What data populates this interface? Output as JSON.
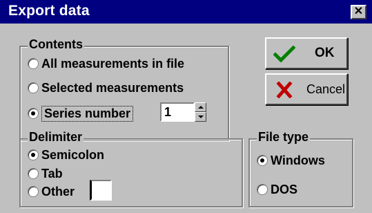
{
  "window": {
    "title": "Export data",
    "close_glyph": "✕"
  },
  "contents": {
    "legend": "Contents",
    "options": [
      {
        "label": "All measurements in file",
        "checked": false
      },
      {
        "label": "Selected measurements",
        "checked": false
      },
      {
        "label": "Series number",
        "checked": true
      }
    ],
    "series_number_value": "1"
  },
  "delimiter": {
    "legend": "Delimiter",
    "options": [
      {
        "label": "Semicolon",
        "checked": true
      },
      {
        "label": "Tab",
        "checked": false
      },
      {
        "label": "Other",
        "checked": false
      }
    ],
    "other_value": ""
  },
  "file_type": {
    "legend": "File type",
    "options": [
      {
        "label": "Windows",
        "checked": true
      },
      {
        "label": "DOS",
        "checked": false
      }
    ]
  },
  "buttons": {
    "ok": {
      "label": "OK",
      "icon": "check-icon",
      "icon_color": "#008000"
    },
    "cancel": {
      "label": "Cancel",
      "icon": "x-icon",
      "icon_color": "#c00000"
    }
  },
  "colors": {
    "titlebar": "#000080",
    "face": "#c0c0c0"
  }
}
